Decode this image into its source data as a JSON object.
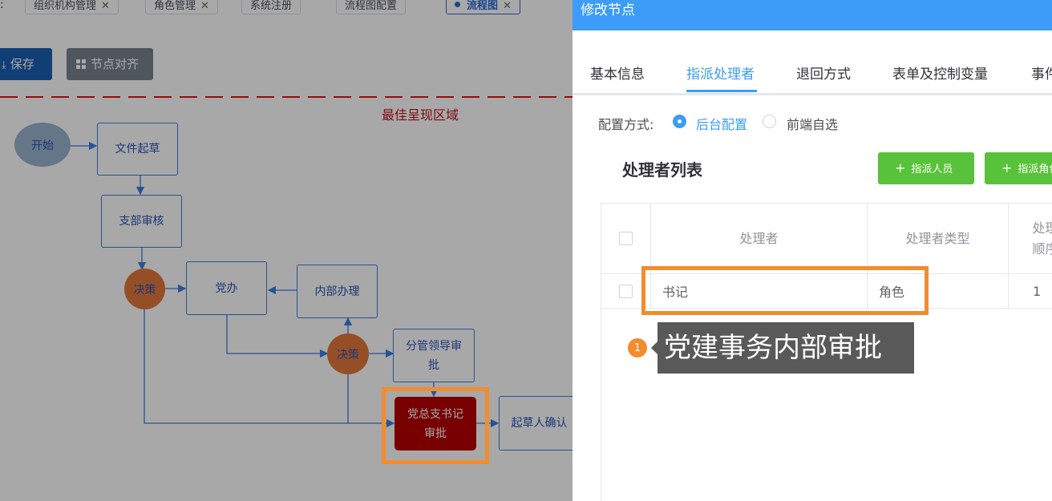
{
  "app_tabs": {
    "lead": ":",
    "items": [
      {
        "label": "组织机构管理"
      },
      {
        "label": "角色管理"
      },
      {
        "label": "系统注册"
      },
      {
        "label": "流程图配置"
      },
      {
        "label": "流程图"
      }
    ],
    "close_glyph": "✕"
  },
  "toolbar": {
    "save_label": "保存",
    "align_label": "节点对齐"
  },
  "canvas": {
    "best_area_label": "最佳呈现区域",
    "nodes": {
      "start": "开始",
      "draft": "文件起草",
      "branch_review": "支部审核",
      "decision1": "决策",
      "party_office": "党办",
      "internal": "内部办理",
      "decision2": "决策",
      "leader_line1": "分管领导审",
      "leader_line2": "批",
      "secretary_line1": "党总支书记",
      "secretary_line2": "审批",
      "confirm": "起草人确认"
    }
  },
  "drawer": {
    "title": "修改节点",
    "tabs": [
      {
        "label": "基本信息"
      },
      {
        "label": "指派处理者"
      },
      {
        "label": "退回方式"
      },
      {
        "label": "表单及控制变量"
      },
      {
        "label": "事件"
      }
    ],
    "config": {
      "label": "配置方式:",
      "option_backend": "后台配置",
      "option_frontend": "前端自选",
      "selected": "后台配置"
    },
    "list_title": "处理者列表",
    "buttons": {
      "assign_person": "指派人员",
      "assign_role": "指派角色"
    },
    "table": {
      "headers": {
        "handler": "处理者",
        "handler_type": "处理者类型",
        "order_line1": "处理",
        "order_line2": "顺序"
      },
      "rows": [
        {
          "handler": "书记",
          "type": "角色",
          "order": "1"
        }
      ]
    }
  },
  "tooltip": {
    "step": "1",
    "text": "党建事务内部审批"
  },
  "colors": {
    "primary": "#3c9cf8",
    "success": "#58c23a",
    "highlight": "#f28c2d",
    "selected_node": "#b70000",
    "decision_node": "#e3793c"
  }
}
